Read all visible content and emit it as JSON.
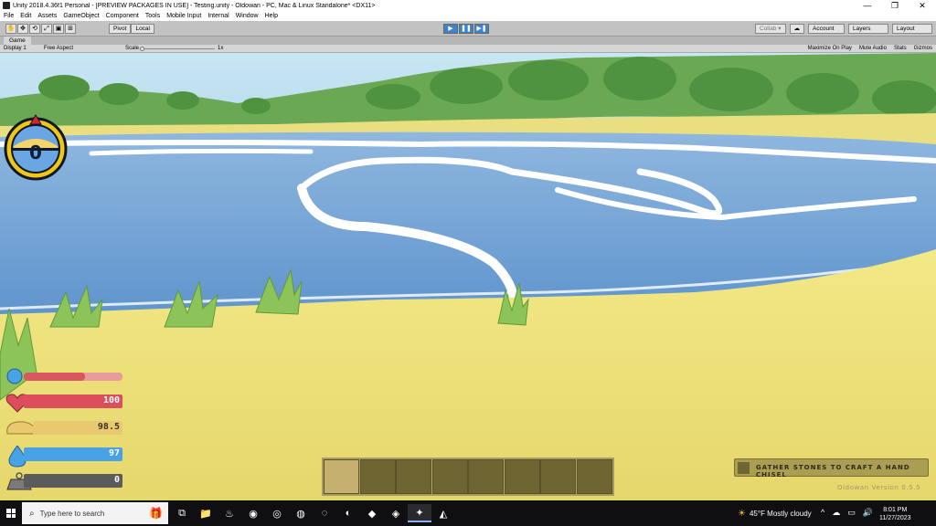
{
  "window": {
    "title": "Unity 2018.4.36f1 Personal - [PREVIEW PACKAGES IN USE] - Testing.unity - Oldowan - PC, Mac & Linux Standalone* <DX11>",
    "controls": {
      "minimize": "—",
      "maximize": "❐",
      "close": "✕"
    }
  },
  "menu": [
    "File",
    "Edit",
    "Assets",
    "GameObject",
    "Component",
    "Tools",
    "Mobile Input",
    "Internal",
    "Window",
    "Help"
  ],
  "toolbar": {
    "tools": [
      "✋",
      "✥",
      "⟲",
      "⤢",
      "▣",
      "⊞"
    ],
    "pivot": "Pivot",
    "local": "Local",
    "play": "▶",
    "pause": "❚❚",
    "step": "▶❚",
    "collab": "Collab ▾",
    "cloud": "☁",
    "account": "Account",
    "layers": "Layers",
    "layout": "Layout"
  },
  "game_tab": {
    "tab_label": "Game",
    "display": "Display 1",
    "aspect": "Free Aspect",
    "scale_label": "Scale",
    "scale_value": "1x",
    "options": [
      "Maximize On Play",
      "Mute Audio",
      "Stats",
      "Gizmos"
    ]
  },
  "hud": {
    "compass_value": "0",
    "stats": [
      {
        "name": "temperature",
        "value": "",
        "fill": 0.62,
        "color": "#e07070",
        "bg": "#f0b8b8"
      },
      {
        "name": "health",
        "value": "100",
        "fill": 1.0,
        "color": "#dc4d5d",
        "bg": "#dc4d5d"
      },
      {
        "name": "hunger",
        "value": "98.5",
        "fill": 0.985,
        "color": "#e9c96f",
        "bg": "#e9c96f"
      },
      {
        "name": "thirst",
        "value": "97",
        "fill": 0.97,
        "color": "#4aa2e6",
        "bg": "#4aa2e6"
      },
      {
        "name": "weight",
        "value": "0",
        "fill": 1.0,
        "color": "#606060",
        "bg": "#606060"
      }
    ],
    "hotbar_slots": 8,
    "task_text": "GATHER STONES TO CRAFT A HAND CHISEL",
    "version": "Oldowan Version 0.5.5"
  },
  "taskbar": {
    "search_placeholder": "Type here to search",
    "apps": [
      "⧉",
      "📁",
      "♨",
      "◉",
      "◎",
      "◍",
      "◌",
      "◐",
      "◆",
      "◈",
      "✦",
      "◭",
      "◒"
    ],
    "weather": "45°F  Mostly cloudy",
    "tray": [
      "^",
      "☁",
      "▭",
      "🔊"
    ],
    "time": "8:01 PM",
    "date": "11/27/2023"
  },
  "colors": {
    "sand": "#ece07a",
    "water": "#6d9ed3",
    "foam": "#ffffff",
    "trees": "#5fa24a"
  }
}
